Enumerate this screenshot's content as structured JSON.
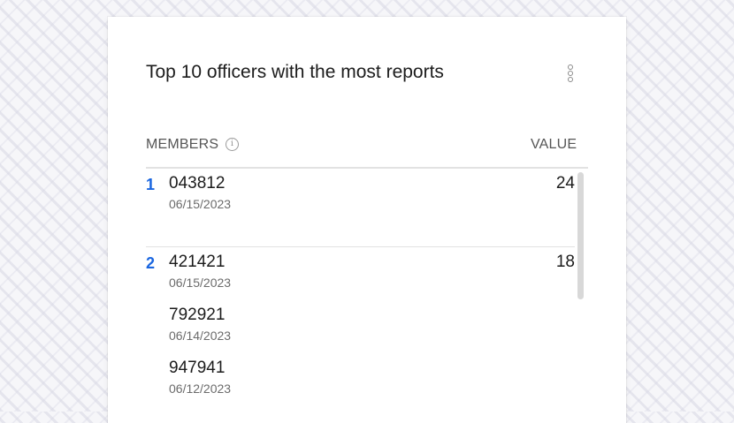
{
  "card": {
    "title": "Top 10 officers with the most reports",
    "menu_icon": "kebab-vertical-icon"
  },
  "table": {
    "columns": {
      "members": "MEMBERS",
      "value": "VALUE"
    },
    "info_icon": "info-icon",
    "rows": [
      {
        "rank": "1",
        "value": "24",
        "entries": [
          {
            "id": "043812",
            "date": "06/15/2023"
          }
        ]
      },
      {
        "rank": "2",
        "value": "18",
        "entries": [
          {
            "id": "421421",
            "date": "06/15/2023"
          },
          {
            "id": "792921",
            "date": "06/14/2023"
          },
          {
            "id": "947941",
            "date": "06/12/2023"
          }
        ]
      }
    ]
  },
  "colors": {
    "rank": "#1a66e0",
    "text": "#1c1c1c",
    "muted": "#6b6b6b"
  }
}
